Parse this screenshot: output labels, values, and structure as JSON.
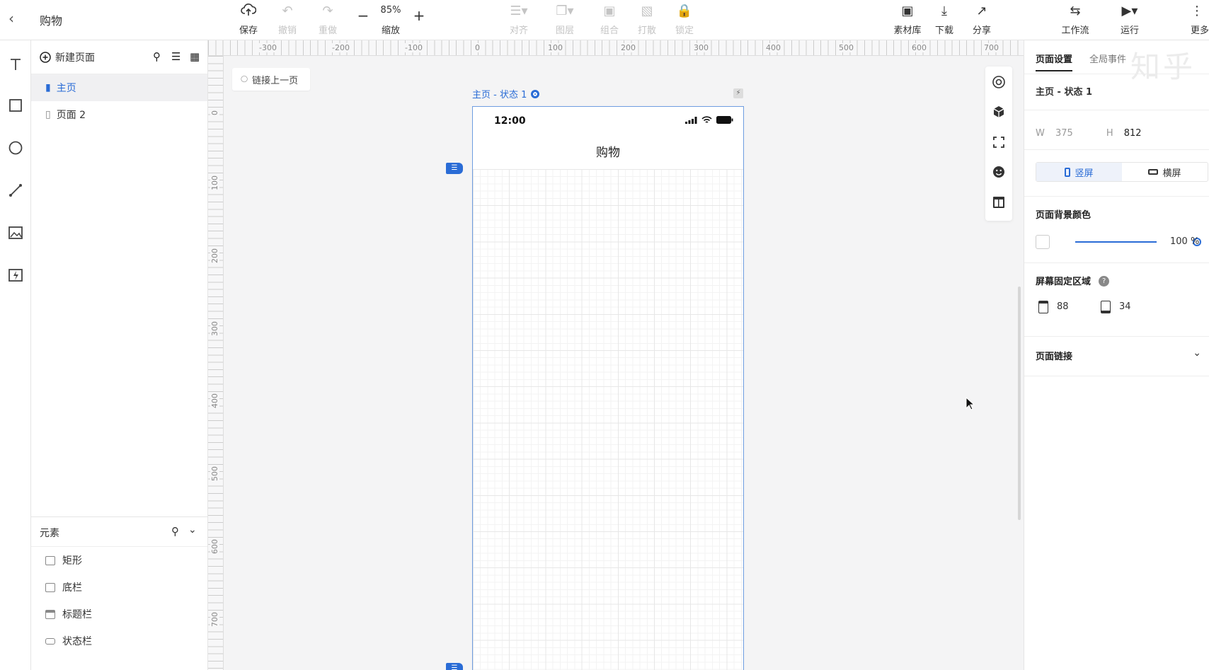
{
  "app": {
    "title": "购物"
  },
  "toolbar": {
    "save": "保存",
    "undo": "撤销",
    "redo": "重做",
    "zoom_value": "85%",
    "zoom_label": "缩放",
    "align": "对齐",
    "layer": "图层",
    "group": "组合",
    "ungroup": "打散",
    "lock": "锁定",
    "assets": "素材库",
    "download": "下载",
    "share": "分享",
    "workflow": "工作流",
    "run": "运行",
    "more": "更多"
  },
  "pages": {
    "new_page": "新建页面",
    "items": [
      {
        "label": "主页",
        "active": true
      },
      {
        "label": "页面 2",
        "active": false
      }
    ]
  },
  "elements": {
    "title": "元素",
    "items": [
      "矩形",
      "底栏",
      "标题栏",
      "状态栏"
    ]
  },
  "canvas": {
    "ruler_top": [
      "-300",
      "-200",
      "-100",
      "0",
      "100",
      "200",
      "300",
      "400",
      "500",
      "600",
      "700"
    ],
    "ruler_left": [
      "0",
      "100",
      "200",
      "300",
      "400",
      "500",
      "600",
      "700"
    ],
    "link_prev": "链接上一页",
    "frame_label": "主页 - 状态 1",
    "phone": {
      "time": "12:00",
      "nav_title": "购物"
    }
  },
  "right_panel": {
    "tab_page_settings": "页面设置",
    "tab_global_events": "全局事件",
    "watermark": "知乎",
    "state_title": "主页 - 状态 1",
    "width_label": "W",
    "width_value": "375",
    "height_label": "H",
    "height_value": "812",
    "portrait": "竖屏",
    "landscape": "横屏",
    "bg_color_title": "页面背景颜色",
    "opacity": "100 %",
    "fixed_area_title": "屏幕固定区域",
    "fixed_top": "88",
    "fixed_bottom": "34",
    "page_link": "页面链接"
  },
  "colors": {
    "accent": "#2a6cd6",
    "frame_border": "#6e9de0"
  }
}
